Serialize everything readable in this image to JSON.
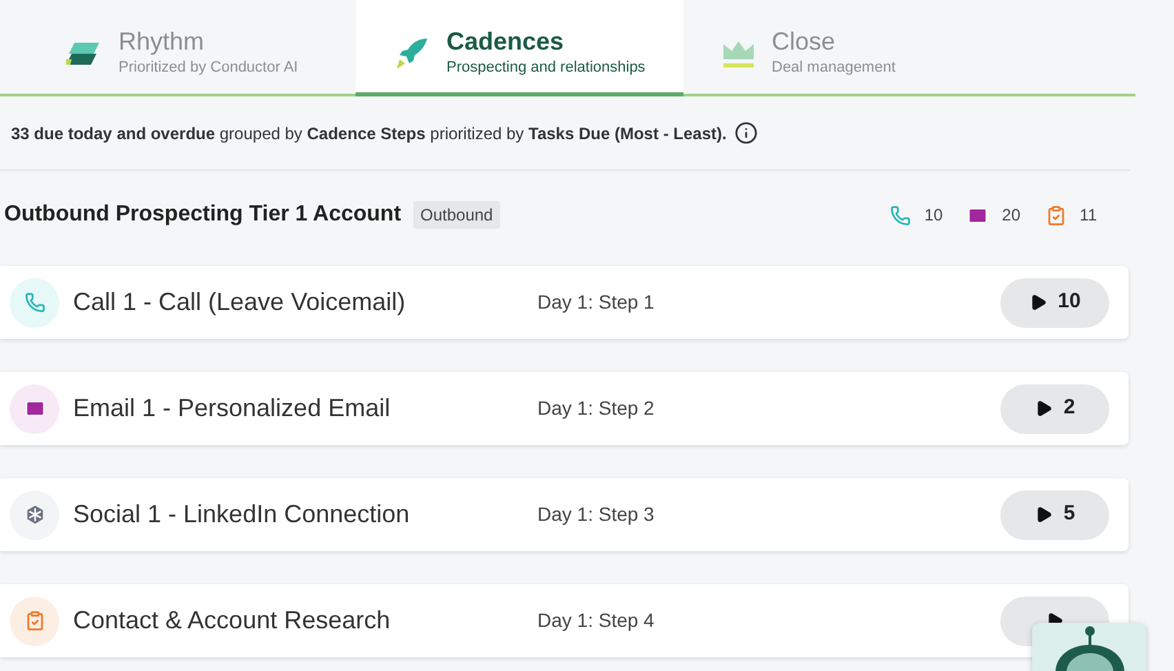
{
  "tabs": [
    {
      "kind": "rhythm",
      "label": "Rhythm",
      "subtitle": "Prioritized by Conductor AI",
      "selected": false
    },
    {
      "kind": "cadences",
      "label": "Cadences",
      "subtitle": "Prospecting and relationships",
      "selected": true
    },
    {
      "kind": "close",
      "label": "Close",
      "subtitle": "Deal management",
      "selected": false
    }
  ],
  "summary": "**33 due today and overdue** grouped by **Cadence Steps** prioritized by **Tasks Due (Most - Least).**",
  "group": {
    "title": "Outbound Prospecting Tier 1 Account",
    "tag": "Outbound",
    "counts": [
      {
        "kind": "call",
        "value": "10"
      },
      {
        "kind": "email",
        "value": "20"
      },
      {
        "kind": "task",
        "value": "11"
      }
    ]
  },
  "steps": [
    {
      "kind": "call",
      "title": "Call 1 - Call (Leave Voicemail)",
      "day": "Day 1: Step 1",
      "count": "10"
    },
    {
      "kind": "email",
      "title": "Email 1 - Personalized Email",
      "day": "Day 1: Step 2",
      "count": "2"
    },
    {
      "kind": "social",
      "title": "Social 1 - LinkedIn Connection",
      "day": "Day 1: Step 3",
      "count": "5"
    },
    {
      "kind": "task",
      "title": "Contact & Account Research",
      "day": "Day 1: Step 4"
    }
  ]
}
